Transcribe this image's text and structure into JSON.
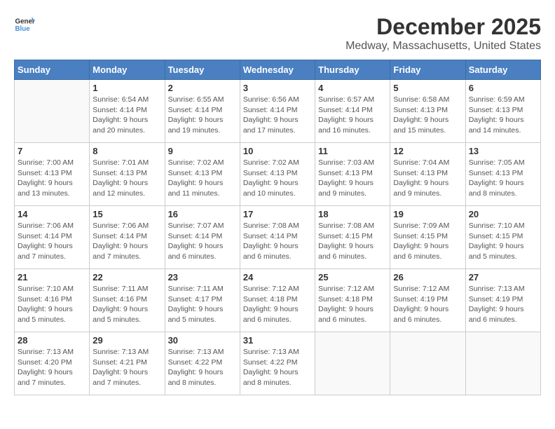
{
  "logo": {
    "text_general": "General",
    "text_blue": "Blue"
  },
  "title": "December 2025",
  "subtitle": "Medway, Massachusetts, United States",
  "days_of_week": [
    "Sunday",
    "Monday",
    "Tuesday",
    "Wednesday",
    "Thursday",
    "Friday",
    "Saturday"
  ],
  "weeks": [
    [
      {
        "day": "",
        "info": ""
      },
      {
        "day": "1",
        "info": "Sunrise: 6:54 AM\nSunset: 4:14 PM\nDaylight: 9 hours\nand 20 minutes."
      },
      {
        "day": "2",
        "info": "Sunrise: 6:55 AM\nSunset: 4:14 PM\nDaylight: 9 hours\nand 19 minutes."
      },
      {
        "day": "3",
        "info": "Sunrise: 6:56 AM\nSunset: 4:14 PM\nDaylight: 9 hours\nand 17 minutes."
      },
      {
        "day": "4",
        "info": "Sunrise: 6:57 AM\nSunset: 4:14 PM\nDaylight: 9 hours\nand 16 minutes."
      },
      {
        "day": "5",
        "info": "Sunrise: 6:58 AM\nSunset: 4:13 PM\nDaylight: 9 hours\nand 15 minutes."
      },
      {
        "day": "6",
        "info": "Sunrise: 6:59 AM\nSunset: 4:13 PM\nDaylight: 9 hours\nand 14 minutes."
      }
    ],
    [
      {
        "day": "7",
        "info": "Sunrise: 7:00 AM\nSunset: 4:13 PM\nDaylight: 9 hours\nand 13 minutes."
      },
      {
        "day": "8",
        "info": "Sunrise: 7:01 AM\nSunset: 4:13 PM\nDaylight: 9 hours\nand 12 minutes."
      },
      {
        "day": "9",
        "info": "Sunrise: 7:02 AM\nSunset: 4:13 PM\nDaylight: 9 hours\nand 11 minutes."
      },
      {
        "day": "10",
        "info": "Sunrise: 7:02 AM\nSunset: 4:13 PM\nDaylight: 9 hours\nand 10 minutes."
      },
      {
        "day": "11",
        "info": "Sunrise: 7:03 AM\nSunset: 4:13 PM\nDaylight: 9 hours\nand 9 minutes."
      },
      {
        "day": "12",
        "info": "Sunrise: 7:04 AM\nSunset: 4:13 PM\nDaylight: 9 hours\nand 9 minutes."
      },
      {
        "day": "13",
        "info": "Sunrise: 7:05 AM\nSunset: 4:13 PM\nDaylight: 9 hours\nand 8 minutes."
      }
    ],
    [
      {
        "day": "14",
        "info": "Sunrise: 7:06 AM\nSunset: 4:14 PM\nDaylight: 9 hours\nand 7 minutes."
      },
      {
        "day": "15",
        "info": "Sunrise: 7:06 AM\nSunset: 4:14 PM\nDaylight: 9 hours\nand 7 minutes."
      },
      {
        "day": "16",
        "info": "Sunrise: 7:07 AM\nSunset: 4:14 PM\nDaylight: 9 hours\nand 6 minutes."
      },
      {
        "day": "17",
        "info": "Sunrise: 7:08 AM\nSunset: 4:14 PM\nDaylight: 9 hours\nand 6 minutes."
      },
      {
        "day": "18",
        "info": "Sunrise: 7:08 AM\nSunset: 4:15 PM\nDaylight: 9 hours\nand 6 minutes."
      },
      {
        "day": "19",
        "info": "Sunrise: 7:09 AM\nSunset: 4:15 PM\nDaylight: 9 hours\nand 6 minutes."
      },
      {
        "day": "20",
        "info": "Sunrise: 7:10 AM\nSunset: 4:15 PM\nDaylight: 9 hours\nand 5 minutes."
      }
    ],
    [
      {
        "day": "21",
        "info": "Sunrise: 7:10 AM\nSunset: 4:16 PM\nDaylight: 9 hours\nand 5 minutes."
      },
      {
        "day": "22",
        "info": "Sunrise: 7:11 AM\nSunset: 4:16 PM\nDaylight: 9 hours\nand 5 minutes."
      },
      {
        "day": "23",
        "info": "Sunrise: 7:11 AM\nSunset: 4:17 PM\nDaylight: 9 hours\nand 5 minutes."
      },
      {
        "day": "24",
        "info": "Sunrise: 7:12 AM\nSunset: 4:18 PM\nDaylight: 9 hours\nand 6 minutes."
      },
      {
        "day": "25",
        "info": "Sunrise: 7:12 AM\nSunset: 4:18 PM\nDaylight: 9 hours\nand 6 minutes."
      },
      {
        "day": "26",
        "info": "Sunrise: 7:12 AM\nSunset: 4:19 PM\nDaylight: 9 hours\nand 6 minutes."
      },
      {
        "day": "27",
        "info": "Sunrise: 7:13 AM\nSunset: 4:19 PM\nDaylight: 9 hours\nand 6 minutes."
      }
    ],
    [
      {
        "day": "28",
        "info": "Sunrise: 7:13 AM\nSunset: 4:20 PM\nDaylight: 9 hours\nand 7 minutes."
      },
      {
        "day": "29",
        "info": "Sunrise: 7:13 AM\nSunset: 4:21 PM\nDaylight: 9 hours\nand 7 minutes."
      },
      {
        "day": "30",
        "info": "Sunrise: 7:13 AM\nSunset: 4:22 PM\nDaylight: 9 hours\nand 8 minutes."
      },
      {
        "day": "31",
        "info": "Sunrise: 7:13 AM\nSunset: 4:22 PM\nDaylight: 9 hours\nand 8 minutes."
      },
      {
        "day": "",
        "info": ""
      },
      {
        "day": "",
        "info": ""
      },
      {
        "day": "",
        "info": ""
      }
    ]
  ]
}
